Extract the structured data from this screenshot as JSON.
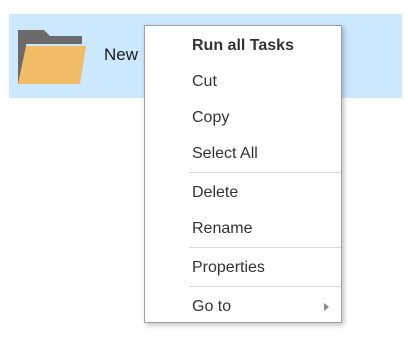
{
  "file_item": {
    "label": "New",
    "icon": "folder-icon",
    "selected_color": "#cce8ff",
    "folder_colors": {
      "back": "#6b6b6b",
      "front": "#f0bd66"
    }
  },
  "context_menu": {
    "items": [
      {
        "label": "Run all Tasks",
        "bold": true
      },
      {
        "label": "Cut"
      },
      {
        "label": "Copy"
      },
      {
        "label": "Select All"
      },
      {
        "label": "Delete"
      },
      {
        "label": "Rename"
      },
      {
        "label": "Properties"
      },
      {
        "label": "Go to",
        "submenu": true
      }
    ],
    "submenu_icon": "chevron-right-icon"
  }
}
